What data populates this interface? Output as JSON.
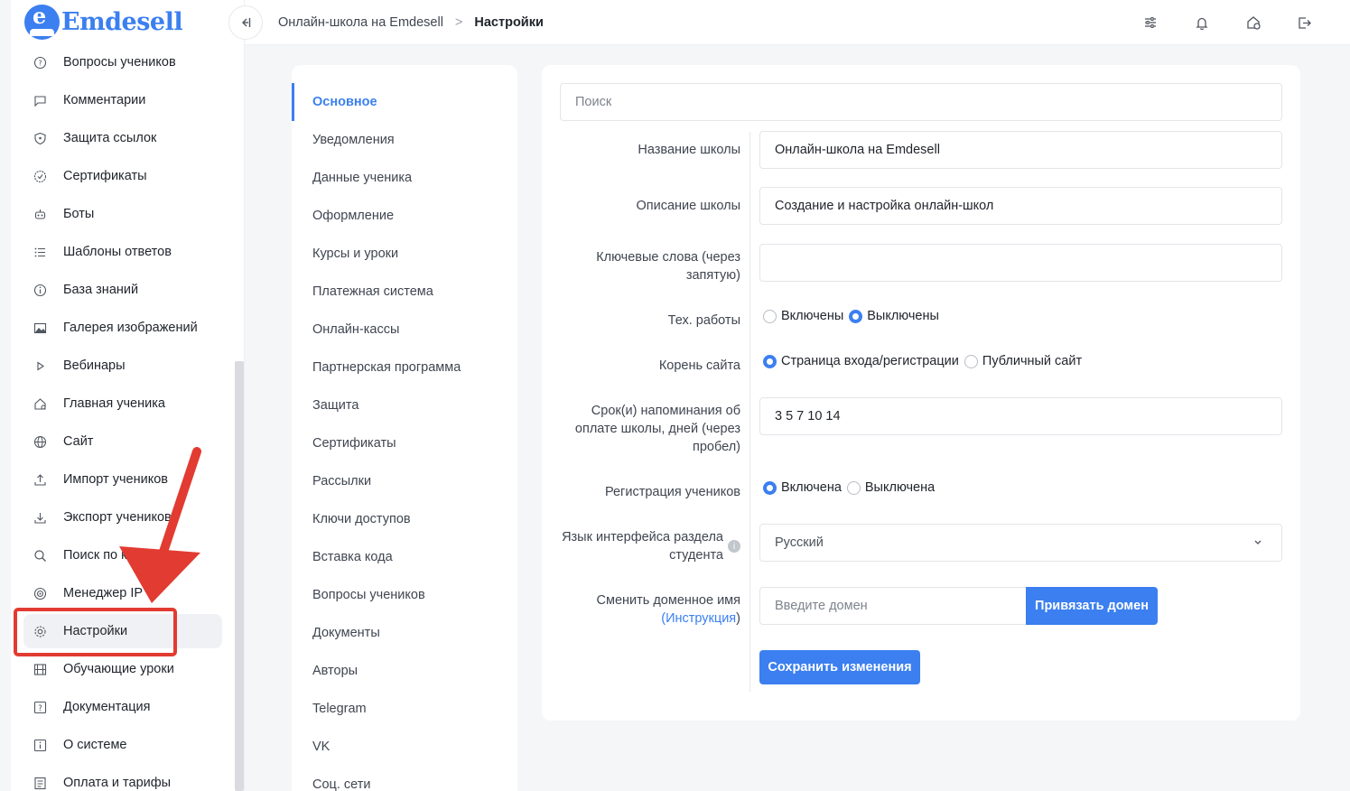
{
  "app": {
    "logo_text": "Emdesell",
    "logo_letter": "e"
  },
  "sidebar": {
    "items": [
      {
        "label": "Вопросы учеников",
        "icon": "question-circle-icon"
      },
      {
        "label": "Комментарии",
        "icon": "comment-icon"
      },
      {
        "label": "Защита ссылок",
        "icon": "shield-icon"
      },
      {
        "label": "Сертификаты",
        "icon": "certificate-icon"
      },
      {
        "label": "Боты",
        "icon": "bot-icon"
      },
      {
        "label": "Шаблоны ответов",
        "icon": "list-icon"
      },
      {
        "label": "База знаний",
        "icon": "info-circle-icon"
      },
      {
        "label": "Галерея изображений",
        "icon": "image-icon"
      },
      {
        "label": "Вебинары",
        "icon": "play-icon"
      },
      {
        "label": "Главная ученика",
        "icon": "home-icon"
      },
      {
        "label": "Сайт",
        "icon": "globe-icon"
      },
      {
        "label": "Импорт учеников",
        "icon": "upload-icon"
      },
      {
        "label": "Экспорт учеников",
        "icon": "download-icon"
      },
      {
        "label": "Поиск по ключам",
        "icon": "search-icon"
      },
      {
        "label": "Менеджер IP",
        "icon": "target-icon"
      },
      {
        "label": "Настройки",
        "icon": "gear-icon",
        "active": true
      },
      {
        "label": "Обучающие уроки",
        "icon": "film-icon"
      },
      {
        "label": "Документация",
        "icon": "help-square-icon"
      },
      {
        "label": "О системе",
        "icon": "info-square-icon"
      },
      {
        "label": "Оплата и тарифы",
        "icon": "invoice-icon"
      }
    ]
  },
  "topbar": {
    "breadcrumb_parent": "Онлайн-школа на Emdesell",
    "breadcrumb_separator": ">",
    "breadcrumb_current": "Настройки",
    "icons": [
      "sliders-icon",
      "bell-icon",
      "home-settings-icon",
      "logout-icon"
    ]
  },
  "settings_menu": {
    "items": [
      {
        "label": "Основное",
        "active": true
      },
      {
        "label": "Уведомления"
      },
      {
        "label": "Данные ученика"
      },
      {
        "label": "Оформление"
      },
      {
        "label": "Курсы и уроки"
      },
      {
        "label": "Платежная система"
      },
      {
        "label": "Онлайн-кассы"
      },
      {
        "label": "Партнерская программа"
      },
      {
        "label": "Защита"
      },
      {
        "label": "Сертификаты"
      },
      {
        "label": "Рассылки"
      },
      {
        "label": "Ключи доступов"
      },
      {
        "label": "Вставка кода"
      },
      {
        "label": "Вопросы учеников"
      },
      {
        "label": "Документы"
      },
      {
        "label": "Авторы"
      },
      {
        "label": "Telegram"
      },
      {
        "label": "VK"
      },
      {
        "label": "Соц. сети"
      }
    ]
  },
  "form": {
    "search_placeholder": "Поиск",
    "school_name": {
      "label": "Название школы",
      "value": "Онлайн-школа на Emdesell"
    },
    "school_description": {
      "label": "Описание школы",
      "value": "Создание и настройка онлайн-школ"
    },
    "keywords": {
      "label_line1": "Ключевые слова (через",
      "label_line2": "запятую)",
      "value": ""
    },
    "maintenance": {
      "label": "Тех. работы",
      "options": [
        "Включены",
        "Выключены"
      ],
      "selected": "Выключены"
    },
    "site_root": {
      "label": "Корень сайта",
      "options": [
        "Страница входа/регистрации",
        "Публичный сайт"
      ],
      "selected": "Страница входа/регистрации"
    },
    "reminders": {
      "label_line1": "Срок(и) напоминания об",
      "label_line2": "оплате школы, дней (через",
      "label_line3": "пробел)",
      "value": "3 5 7 10 14"
    },
    "registration": {
      "label": "Регистрация учеников",
      "options": [
        "Включена",
        "Выключена"
      ],
      "selected": "Включена"
    },
    "language": {
      "label_line1": "Язык интерфейса раздела",
      "label_line2": "студента",
      "value": "Русский",
      "info": "i"
    },
    "domain": {
      "label_line1": "Сменить доменное имя",
      "label_open": "(",
      "label_link": "Инструкция",
      "label_close": ")",
      "placeholder": "Введите домен",
      "button": "Привязать домен"
    },
    "save_button": "Сохранить изменения"
  },
  "colors": {
    "accent": "#3b7ff0",
    "annotation": "#e23b31"
  }
}
